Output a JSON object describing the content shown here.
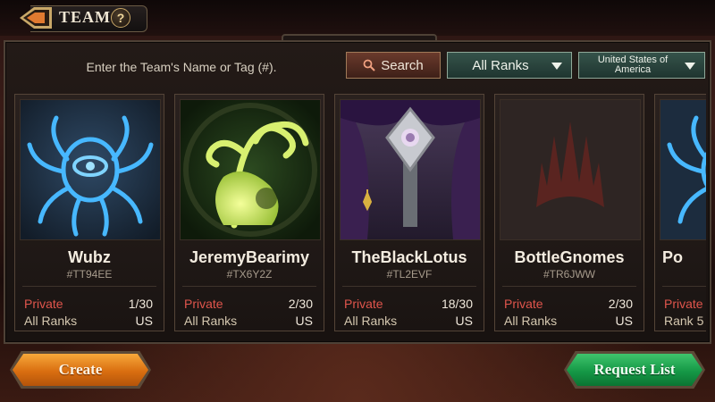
{
  "header": {
    "title": "TEAM",
    "help_label": "?",
    "back_icon": "back-arrow-icon"
  },
  "search": {
    "placeholder": "Enter the Team's Name or Tag (#).",
    "button_label": "Search"
  },
  "filters": {
    "rank": "All Ranks",
    "country": "United States of America"
  },
  "teams": [
    {
      "name": "Wubz",
      "tag": "#TT94EE",
      "privacy": "Private",
      "members": "1/30",
      "rank": "All Ranks",
      "country": "US",
      "emblem": "spider-eye-emblem"
    },
    {
      "name": "JeremyBearimy",
      "tag": "#TX6Y2Z",
      "privacy": "Private",
      "members": "2/30",
      "rank": "All Ranks",
      "country": "US",
      "emblem": "swirling-tree-emblem"
    },
    {
      "name": "TheBlackLotus",
      "tag": "#TL2EVF",
      "privacy": "Private",
      "members": "18/30",
      "rank": "All Ranks",
      "country": "US",
      "emblem": "black-lotus-emblem"
    },
    {
      "name": "BottleGnomes",
      "tag": "#TR6JWW",
      "privacy": "Private",
      "members": "2/30",
      "rank": "All Ranks",
      "country": "US",
      "emblem": "planeswalker-sigil-emblem"
    },
    {
      "name": "Po",
      "tag": "",
      "privacy": "Private",
      "members": "",
      "rank": "Rank 5",
      "country": "",
      "emblem": "spider-eye-emblem"
    }
  ],
  "footer": {
    "create_label": "Create",
    "request_label": "Request List"
  },
  "colors": {
    "private": "#e0554c",
    "create": "#e07a18",
    "request": "#18a04c",
    "filter": "#2c4a42"
  }
}
